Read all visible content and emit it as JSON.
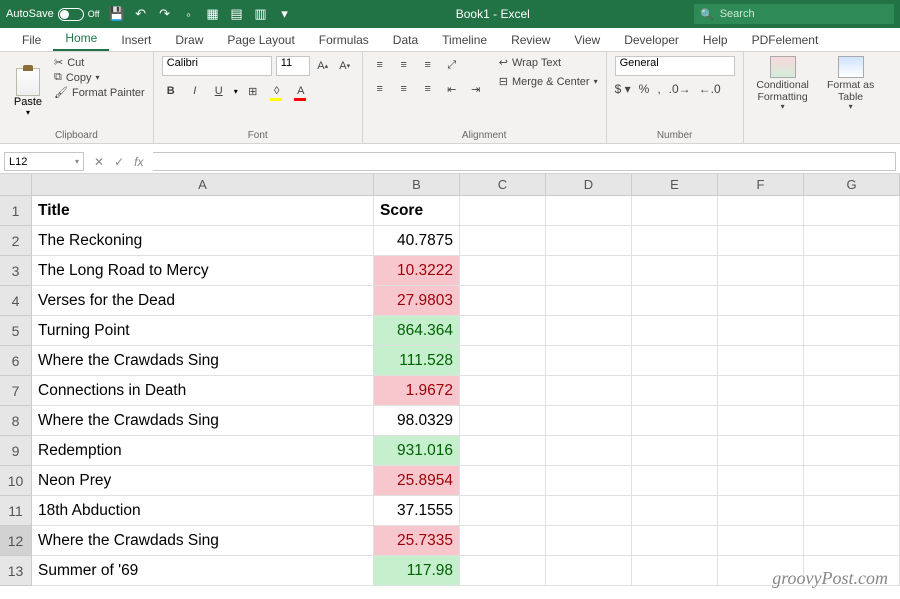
{
  "titlebar": {
    "autosave_label": "AutoSave",
    "autosave_state": "Off",
    "title": "Book1 - Excel",
    "search_placeholder": "Search"
  },
  "tabs": [
    "File",
    "Home",
    "Insert",
    "Draw",
    "Page Layout",
    "Formulas",
    "Data",
    "Timeline",
    "Review",
    "View",
    "Developer",
    "Help",
    "PDFelement"
  ],
  "active_tab": "Home",
  "ribbon": {
    "clipboard": {
      "paste": "Paste",
      "cut": "Cut",
      "copy": "Copy",
      "format_painter": "Format Painter",
      "label": "Clipboard"
    },
    "font": {
      "name": "Calibri",
      "size": "11",
      "label": "Font"
    },
    "alignment": {
      "wrap": "Wrap Text",
      "merge": "Merge & Center",
      "label": "Alignment"
    },
    "number": {
      "format": "General",
      "label": "Number"
    },
    "styles": {
      "cond": "Conditional Formatting",
      "table": "Format as Table"
    }
  },
  "namebox": "L12",
  "columns": [
    "A",
    "B",
    "C",
    "D",
    "E",
    "F",
    "G"
  ],
  "headers": {
    "A": "Title",
    "B": "Score"
  },
  "rows": [
    {
      "n": 1,
      "title": "Title",
      "score": "Score",
      "fmt": "header"
    },
    {
      "n": 2,
      "title": "The Reckoning",
      "score": "40.7875",
      "fmt": ""
    },
    {
      "n": 3,
      "title": "The Long Road to Mercy",
      "score": "10.3222",
      "fmt": "red"
    },
    {
      "n": 4,
      "title": "Verses for the Dead",
      "score": "27.9803",
      "fmt": "red"
    },
    {
      "n": 5,
      "title": "Turning Point",
      "score": "864.364",
      "fmt": "green"
    },
    {
      "n": 6,
      "title": "Where the Crawdads Sing",
      "score": "111.528",
      "fmt": "green"
    },
    {
      "n": 7,
      "title": "Connections in Death",
      "score": "1.9672",
      "fmt": "red"
    },
    {
      "n": 8,
      "title": "Where the Crawdads Sing",
      "score": "98.0329",
      "fmt": ""
    },
    {
      "n": 9,
      "title": "Redemption",
      "score": "931.016",
      "fmt": "green"
    },
    {
      "n": 10,
      "title": "Neon Prey",
      "score": "25.8954",
      "fmt": "red"
    },
    {
      "n": 11,
      "title": "18th Abduction",
      "score": "37.1555",
      "fmt": ""
    },
    {
      "n": 12,
      "title": "Where the Crawdads Sing",
      "score": "25.7335",
      "fmt": "red",
      "selected": true
    },
    {
      "n": 13,
      "title": "Summer of '69",
      "score": "117.98",
      "fmt": "green"
    }
  ],
  "watermark": "groovyPost.com"
}
